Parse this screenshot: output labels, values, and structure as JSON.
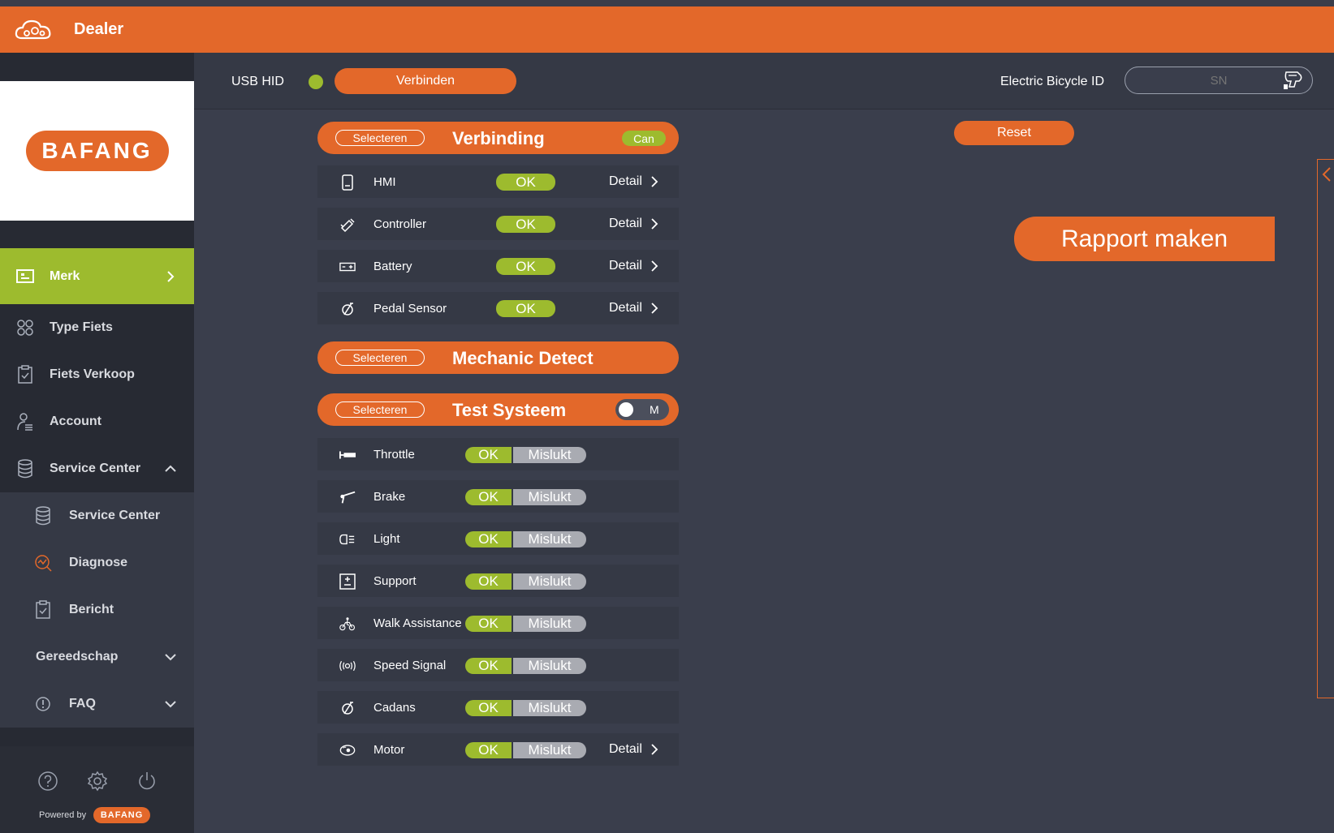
{
  "header": {
    "title": "Dealer",
    "icon": "cloud-gear-icon"
  },
  "logo": {
    "text": "BAFANG"
  },
  "sidebar": {
    "items": [
      {
        "label": "Merk",
        "icon": "display-icon",
        "active": true
      },
      {
        "label": "Type Fiets",
        "icon": "grid-icon"
      },
      {
        "label": "Fiets Verkoop",
        "icon": "clipboard-check-icon"
      },
      {
        "label": "Account",
        "icon": "person-icon"
      },
      {
        "label": "Service Center",
        "icon": "database-icon",
        "expanded": true
      }
    ],
    "sub_items": [
      {
        "label": "Service Center",
        "icon": "database-icon"
      },
      {
        "label": "Diagnose",
        "icon": "diagnose-icon"
      },
      {
        "label": "Bericht",
        "icon": "clipboard-check-icon"
      },
      {
        "label": "Gereedschap",
        "icon": ""
      },
      {
        "label": "FAQ",
        "icon": "info-icon"
      }
    ],
    "bottom_icons": [
      "help-icon",
      "gear-icon",
      "power-icon"
    ],
    "powered_by": "Powered by",
    "powered_logo": "BAFANG"
  },
  "connection": {
    "usb_label": "USB HID",
    "connect_label": "Verbinden",
    "bike_id_label": "Electric Bicycle ID",
    "sn_placeholder": "SN",
    "status_color": "#9dbb2e"
  },
  "sections": {
    "select_label": "Selecteren",
    "verbinding": {
      "title": "Verbinding",
      "badge": "Can"
    },
    "mechanic": {
      "title": "Mechanic Detect"
    },
    "test": {
      "title": "Test Systeem",
      "toggle_label": "M"
    }
  },
  "verbinding_rows": [
    {
      "name": "HMI",
      "status": "OK",
      "detail": "Detail",
      "icon": "display-device-icon"
    },
    {
      "name": "Controller",
      "status": "OK",
      "detail": "Detail",
      "icon": "controller-icon"
    },
    {
      "name": "Battery",
      "status": "OK",
      "detail": "Detail",
      "icon": "battery-icon"
    },
    {
      "name": "Pedal Sensor",
      "status": "OK",
      "detail": "Detail",
      "icon": "pedal-sensor-icon"
    }
  ],
  "test_rows": [
    {
      "name": "Throttle",
      "ok": "OK",
      "fail": "Mislukt",
      "icon": "throttle-icon"
    },
    {
      "name": "Brake",
      "ok": "OK",
      "fail": "Mislukt",
      "icon": "brake-icon"
    },
    {
      "name": "Light",
      "ok": "OK",
      "fail": "Mislukt",
      "icon": "light-icon"
    },
    {
      "name": "Support",
      "ok": "OK",
      "fail": "Mislukt",
      "icon": "support-icon"
    },
    {
      "name": "Walk Assistance",
      "ok": "OK",
      "fail": "Mislukt",
      "icon": "walk-assist-icon"
    },
    {
      "name": "Speed Signal",
      "ok": "OK",
      "fail": "Mislukt",
      "icon": "speed-signal-icon"
    },
    {
      "name": "Cadans",
      "ok": "OK",
      "fail": "Mislukt",
      "icon": "cadence-icon"
    },
    {
      "name": "Motor",
      "ok": "OK",
      "fail": "Mislukt",
      "detail": "Detail",
      "icon": "motor-icon"
    }
  ],
  "actions": {
    "reset": "Reset",
    "report": "Rapport maken"
  },
  "colors": {
    "accent": "#e3682a",
    "success": "#9dbb2e",
    "fail": "#a9abb2"
  }
}
